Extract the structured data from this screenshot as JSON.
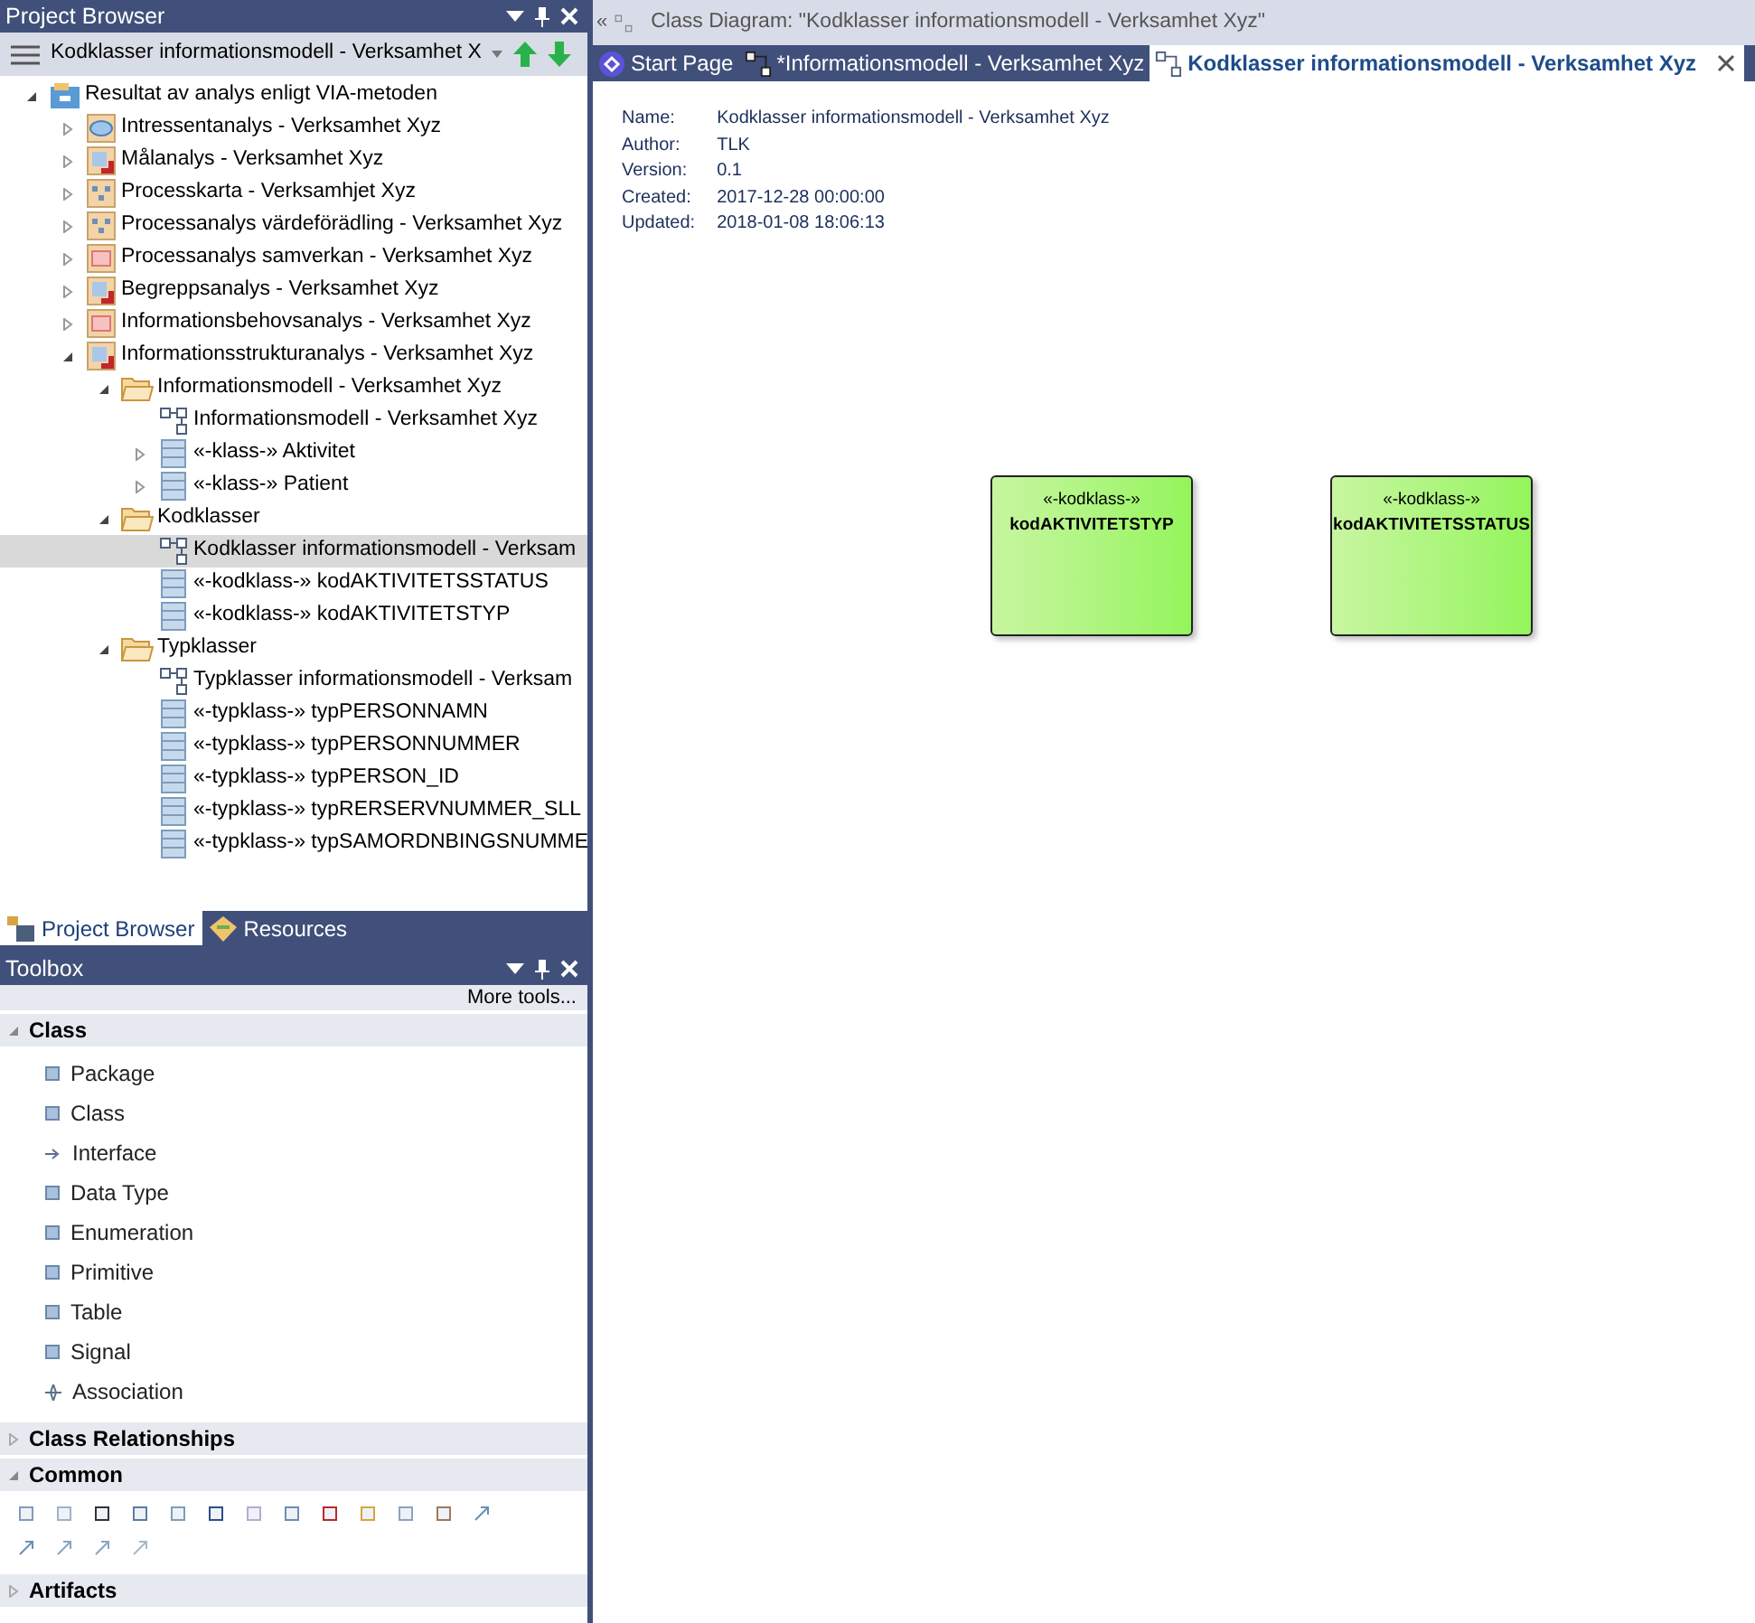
{
  "project_browser": {
    "title": "Project Browser",
    "current": "Kodklasser informationsmodell - Verksamhet X",
    "tree": [
      {
        "label": "Resultat av analys enligt VIA-metoden",
        "kind": "root",
        "expanded": true,
        "selected": false,
        "children": [
          {
            "label": "Intressentanalys - Verksamhet Xyz",
            "kind": "oval",
            "expanded": false,
            "selected": false
          },
          {
            "label": "Målanalys - Verksamhet Xyz",
            "kind": "red",
            "expanded": false,
            "selected": false
          },
          {
            "label": "Processkarta - Verksamhjet Xyz",
            "kind": "process",
            "expanded": false,
            "selected": false
          },
          {
            "label": "Processanalys värdeförädling - Verksamhet Xyz",
            "kind": "process",
            "expanded": false,
            "selected": false
          },
          {
            "label": "Processanalys samverkan - Verksamhet Xyz",
            "kind": "pink",
            "expanded": false,
            "selected": false
          },
          {
            "label": "Begreppsanalys - Verksamhet Xyz",
            "kind": "red",
            "expanded": false,
            "selected": false
          },
          {
            "label": "Informationsbehovsanalys - Verksamhet Xyz",
            "kind": "pink",
            "expanded": false,
            "selected": false
          },
          {
            "label": "Informationsstrukturanalys - Verksamhet Xyz",
            "kind": "red",
            "expanded": true,
            "selected": false,
            "children": [
              {
                "label": "Informationsmodell - Verksamhet Xyz",
                "kind": "folder",
                "expanded": true,
                "selected": false,
                "children": [
                  {
                    "label": "Informationsmodell - Verksamhet Xyz",
                    "kind": "diagram",
                    "selected": false
                  },
                  {
                    "label": "«-klass-» Aktivitet",
                    "kind": "class",
                    "expanded": false,
                    "selected": false
                  },
                  {
                    "label": "«-klass-» Patient",
                    "kind": "class",
                    "expanded": false,
                    "selected": false
                  }
                ]
              },
              {
                "label": "Kodklasser",
                "kind": "folder",
                "expanded": true,
                "selected": false,
                "children": [
                  {
                    "label": "Kodklasser informationsmodell - Verksam",
                    "kind": "diagram",
                    "selected": true
                  },
                  {
                    "label": "«-kodklass-» kodAKTIVITETSSTATUS",
                    "kind": "class",
                    "selected": false
                  },
                  {
                    "label": "«-kodklass-» kodAKTIVITETSTYP",
                    "kind": "class",
                    "selected": false
                  }
                ]
              },
              {
                "label": "Typklasser",
                "kind": "folder",
                "expanded": true,
                "selected": false,
                "children": [
                  {
                    "label": "Typklasser informationsmodell - Verksam",
                    "kind": "diagram",
                    "selected": false
                  },
                  {
                    "label": "«-typklass-» typPERSONNAMN",
                    "kind": "class",
                    "selected": false
                  },
                  {
                    "label": "«-typklass-» typPERSONNUMMER",
                    "kind": "class",
                    "selected": false
                  },
                  {
                    "label": "«-typklass-» typPERSON_ID",
                    "kind": "class",
                    "selected": false
                  },
                  {
                    "label": "«-typklass-» typRERSERVNUMMER_SLL",
                    "kind": "class",
                    "selected": false
                  },
                  {
                    "label": "«-typklass-» typSAMORDNBINGSNUMME",
                    "kind": "class",
                    "selected": false
                  }
                ]
              }
            ]
          }
        ]
      }
    ],
    "tabs": [
      {
        "label": "Project Browser",
        "selected": true
      },
      {
        "label": "Resources",
        "selected": false
      }
    ]
  },
  "toolbox": {
    "title": "Toolbox",
    "more": "More tools...",
    "groups": [
      {
        "label": "Class",
        "expanded": true,
        "kind": "list",
        "items": [
          "Package",
          "Class",
          "Interface",
          "Data Type",
          "Enumeration",
          "Primitive",
          "Table",
          "Signal",
          "Association"
        ]
      },
      {
        "label": "Class Relationships",
        "expanded": false
      },
      {
        "label": "Common",
        "expanded": true,
        "kind": "icons"
      },
      {
        "label": "Artifacts",
        "expanded": false
      }
    ]
  },
  "diagram": {
    "collapse": "«",
    "breadcrumb": "Class Diagram: \"Kodklasser informationsmodell - Verksamhet Xyz\"",
    "tabs": [
      {
        "label": "Start Page",
        "selected": false
      },
      {
        "label": "*Informationsmodell - Verksamhet Xyz",
        "selected": false
      },
      {
        "label": "Kodklasser informationsmodell - Verksamhet Xyz",
        "selected": true
      }
    ],
    "info": [
      {
        "key": "Name:",
        "value": "Kodklasser informationsmodell - Verksamhet Xyz"
      },
      {
        "key": "Author:",
        "value": "TLK"
      },
      {
        "key": "Version:",
        "value": "0.1"
      },
      {
        "key": "Created:",
        "value": "2017-12-28 00:00:00"
      },
      {
        "key": "Updated:",
        "value": "2018-01-08 18:06:13"
      }
    ],
    "elements": [
      {
        "stereotype": "«-kodklass-»",
        "name": "kodAKTIVITETSTYP"
      },
      {
        "stereotype": "«-kodklass-»",
        "name": "kodAKTIVITETSSTATUS"
      }
    ]
  }
}
